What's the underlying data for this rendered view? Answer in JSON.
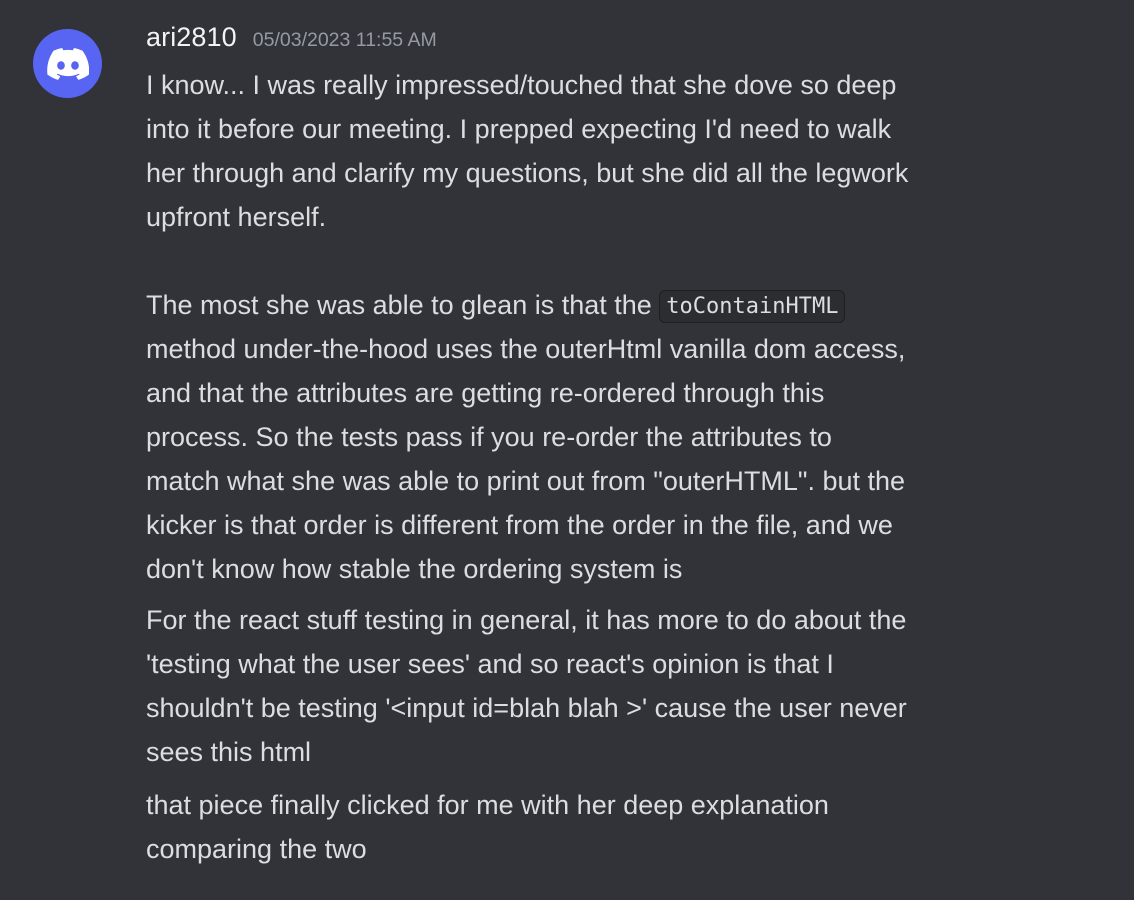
{
  "author": {
    "username": "ari2810",
    "timestamp": "05/03/2023 11:55 AM",
    "avatar_icon": "discord-logo-icon",
    "avatar_color": "#5865f2"
  },
  "messages": [
    {
      "lines": [
        "I know... I was really impressed/touched that she dove so deep",
        "into it before our meeting. I prepped expecting I'd need to walk",
        "her through and clarify my questions, but she did all the legwork",
        "upfront herself."
      ],
      "para2_line1_prefix": "The most she was able to glean is that the ",
      "para2_code": "toContainHTML",
      "para2_lines": [
        "method under-the-hood uses the outerHtml vanilla dom access,",
        "and that the attributes are getting re-ordered through this",
        "process. So the tests pass if you re-order the attributes to",
        "match what she was able to print out from \"outerHTML\".  but the",
        "kicker is that order is different from the order in the file, and we",
        "don't know how stable the ordering system is"
      ]
    },
    {
      "lines": [
        "For the react stuff testing in general, it has more to do about the",
        "'testing what the user sees' and so react's opinion is that I",
        "shouldn't be testing '<input id=blah blah >' cause the user never",
        "sees this html"
      ]
    },
    {
      "lines": [
        "that piece finally clicked for me with her deep explanation",
        "comparing the two"
      ]
    }
  ],
  "colors": {
    "background": "#313338",
    "text": "#dbdee1",
    "username": "#f2f3f5",
    "timestamp": "#949ba4",
    "code_bg": "#2b2d31"
  }
}
